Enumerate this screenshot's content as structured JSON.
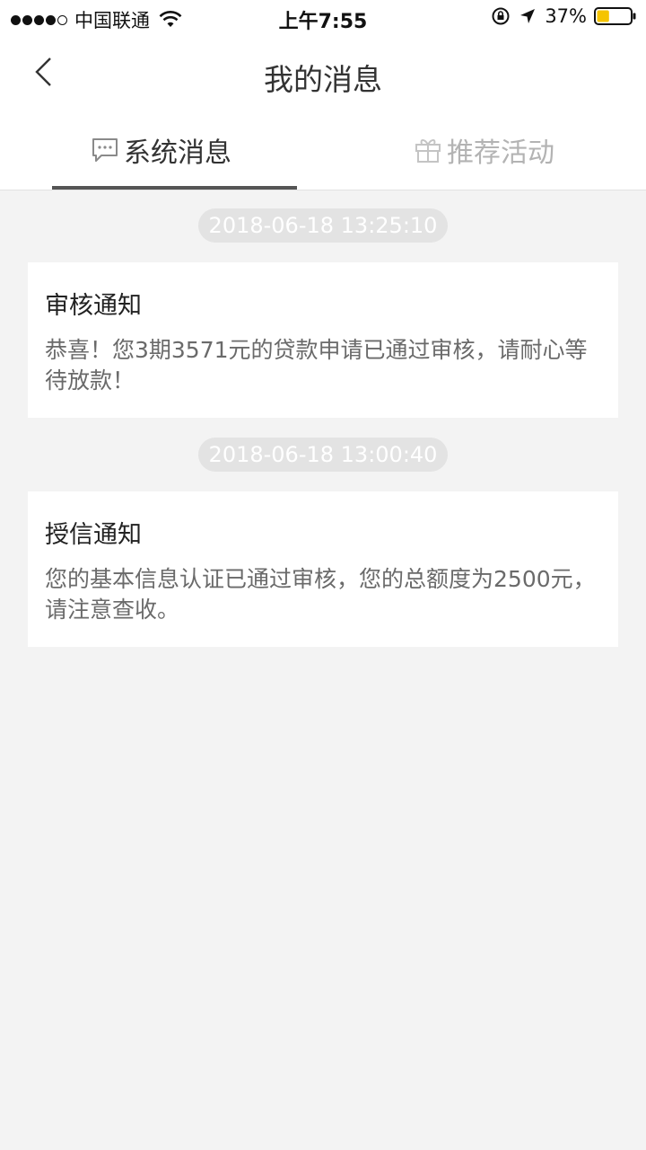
{
  "status_bar": {
    "carrier": "中国联通",
    "time": "上午7:55",
    "battery_percent": "37%",
    "battery_level": 0.37,
    "accent_color": "#f5c400"
  },
  "nav": {
    "title": "我的消息",
    "back_icon": "chevron-left-icon"
  },
  "tabs": [
    {
      "label": "系统消息",
      "icon": "chat-bubble-icon",
      "active": true
    },
    {
      "label": "推荐活动",
      "icon": "gift-icon",
      "active": false
    }
  ],
  "messages": [
    {
      "time": "2018-06-18 13:25:10",
      "title": "审核通知",
      "body": "恭喜！您3期3571元的贷款申请已通过审核，请耐心等待放款！"
    },
    {
      "time": "2018-06-18 13:00:40",
      "title": "授信通知",
      "body": "您的基本信息认证已通过审核，您的总额度为2500元，请注意查收。"
    }
  ]
}
